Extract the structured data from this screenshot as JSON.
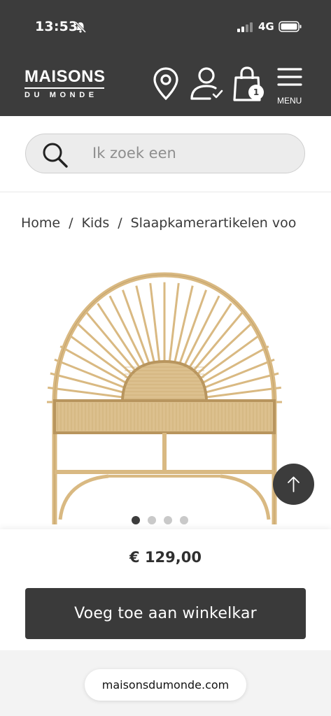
{
  "status_bar": {
    "time": "13:53",
    "network": "4G",
    "icons": [
      "bell-muted-icon",
      "signal-icon",
      "battery-icon"
    ]
  },
  "header": {
    "logo_main": "MAISONS",
    "logo_sub": "DU MONDE",
    "menu_label": "MENU",
    "cart_count": "1",
    "icons": [
      "location-pin-icon",
      "account-icon",
      "shopping-bag-icon",
      "hamburger-menu-icon"
    ]
  },
  "search": {
    "placeholder": "Ik zoek een"
  },
  "breadcrumb": {
    "items": [
      "Home",
      "Kids",
      "Slaapkamerartikelen voo"
    ],
    "separator": "/"
  },
  "product": {
    "image_alt": "Rattan headboard with sunburst design",
    "carousel_total": 4,
    "carousel_active": 1,
    "price": "€ 129,00",
    "add_to_cart_label": "Voeg toe aan winkelkar"
  },
  "browser": {
    "url": "maisonsdumonde.com"
  },
  "colors": {
    "header_bg": "#3c3c3c",
    "button_bg": "#3a3a3a",
    "rattan": "#d9b982"
  }
}
